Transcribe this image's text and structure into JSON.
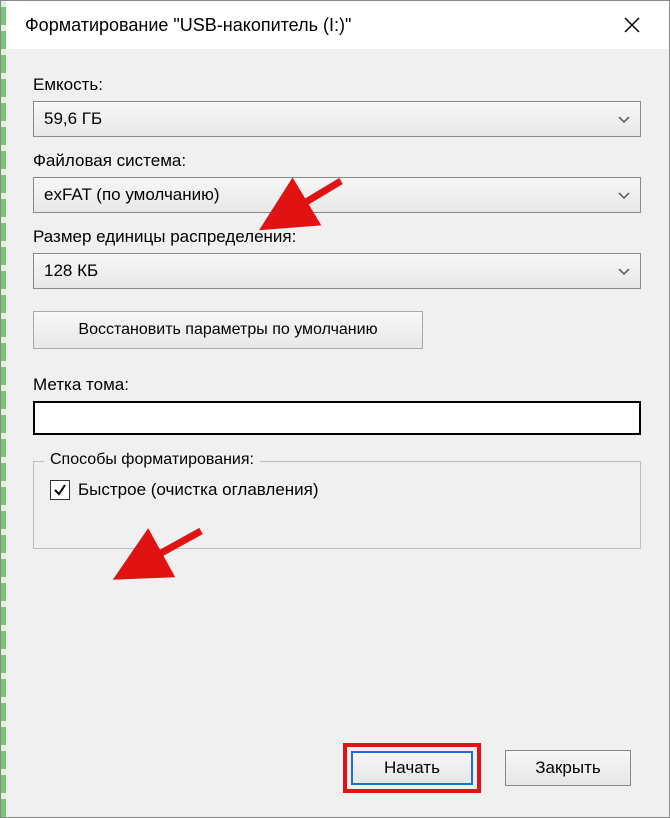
{
  "title": "Форматирование \"USB-накопитель (I:)\"",
  "capacity": {
    "label": "Емкость:",
    "value": "59,6 ГБ"
  },
  "filesystem": {
    "label": "Файловая система:",
    "value": "exFAT (по умолчанию)"
  },
  "allocation": {
    "label": "Размер единицы распределения:",
    "value": "128 КБ"
  },
  "restore_defaults": "Восстановить параметры по умолчанию",
  "volume_label": {
    "label": "Метка тома:",
    "value": ""
  },
  "format_options": {
    "legend": "Способы форматирования:",
    "quick_label": "Быстрое (очистка оглавления)",
    "quick_checked": true
  },
  "buttons": {
    "start": "Начать",
    "close": "Закрыть"
  }
}
